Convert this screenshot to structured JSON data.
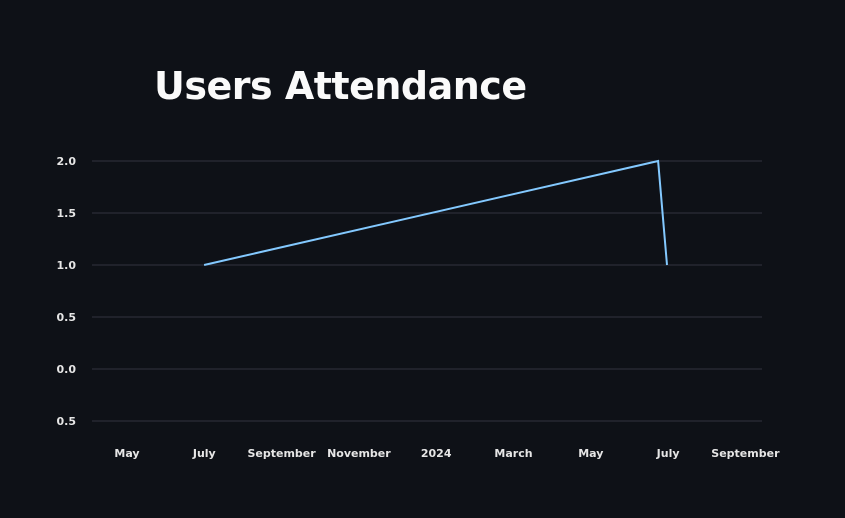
{
  "page": {
    "title": "Users Attendance"
  },
  "chart_data": {
    "type": "line",
    "title": "Users Attendance",
    "xlabel": "",
    "ylabel": "",
    "x_ticks": [
      "May",
      "July",
      "September",
      "November",
      "2024",
      "March",
      "May",
      "July",
      "September"
    ],
    "y_ticks": [
      "2.0",
      "1.5",
      "1.0",
      "0.5",
      "0.0",
      "0.5"
    ],
    "ylim": [
      -0.5,
      2.0
    ],
    "grid": true,
    "legend": "none",
    "series": [
      {
        "color": "#83c9ff",
        "x": [
          "2023-07-01",
          "2024-06-24",
          "2024-07-01"
        ],
        "y": [
          1,
          2,
          1
        ]
      }
    ]
  },
  "colors": {
    "background": "#0e1117",
    "grid": "#31333f",
    "text": "#fafafa",
    "series": "#83c9ff"
  }
}
